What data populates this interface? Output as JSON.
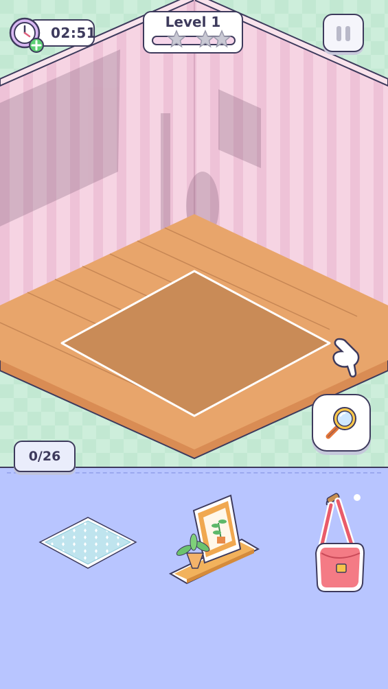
{
  "hud": {
    "timer": "02:51",
    "timer_icon": "clock-add-time-icon",
    "level_label": "Level 1",
    "stars_total": 3,
    "stars_earned": 0,
    "level_progress": 0.0,
    "pause_icon": "pause-icon"
  },
  "room": {
    "wall_color": "#f4cfe0",
    "wall_stripe_color": "#eebfd6",
    "floor_color": "#e5a066",
    "target_zone_color": "#c88a55",
    "hint_icon": "pointing-hand-icon"
  },
  "tools": {
    "magnifier_icon": "magnifier-icon"
  },
  "inventory": {
    "counter": "0/26",
    "items": [
      {
        "name": "patterned-rug",
        "icon": "rug-icon"
      },
      {
        "name": "wall-shelf-with-plant-and-picture-frame",
        "icon": "shelf-icon"
      },
      {
        "name": "pink-shoulder-bag",
        "icon": "handbag-icon"
      }
    ]
  },
  "colors": {
    "outline": "#3d3a5c",
    "tray": "#b8c5ff",
    "background": "#cfeedd"
  }
}
